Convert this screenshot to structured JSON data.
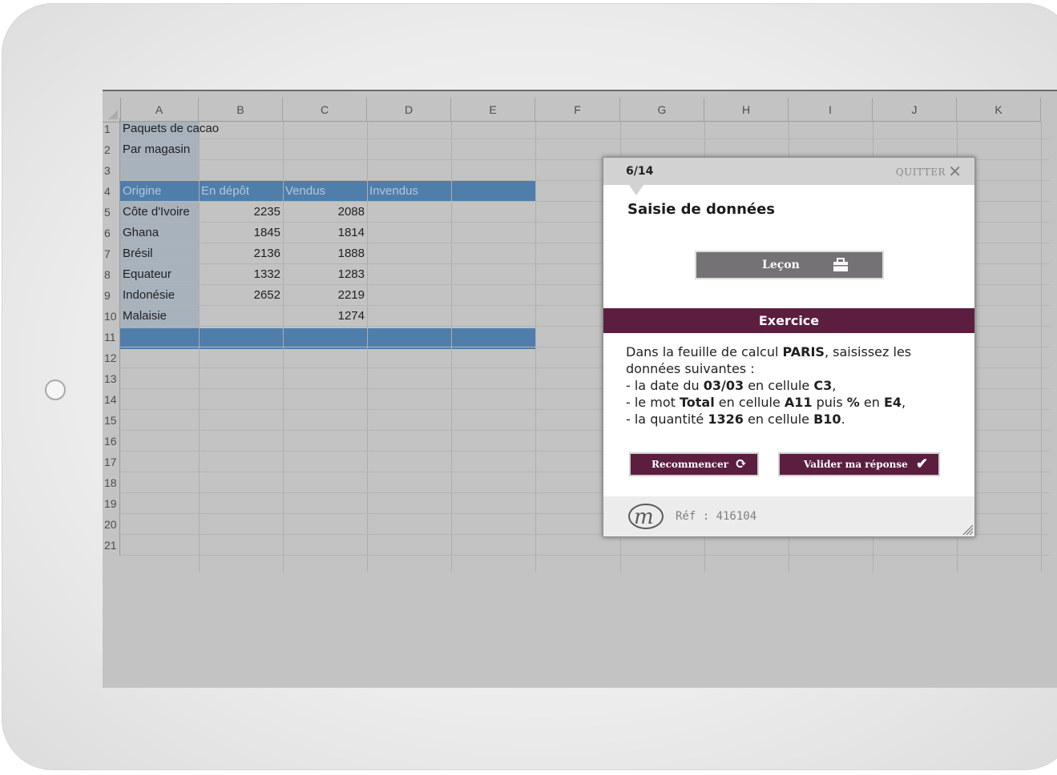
{
  "sheet": {
    "columns": [
      "A",
      "B",
      "C",
      "D",
      "E",
      "F",
      "G",
      "H",
      "I",
      "J",
      "K"
    ],
    "rows": [
      "1",
      "2",
      "3",
      "4",
      "5",
      "6",
      "7",
      "8",
      "9",
      "10",
      "11",
      "12",
      "13",
      "14",
      "15",
      "16",
      "17",
      "18",
      "19",
      "20",
      "21"
    ],
    "a1": "Paquets de cacao",
    "a2": "Par magasin",
    "headers": [
      "Origine",
      "En dépôt",
      "Vendus",
      "Invendus"
    ],
    "data": [
      {
        "origin": "Côte d'Ivoire",
        "stock": "2235",
        "sold": "2088"
      },
      {
        "origin": "Ghana",
        "stock": "1845",
        "sold": "1814"
      },
      {
        "origin": "Brésil",
        "stock": "2136",
        "sold": "1888"
      },
      {
        "origin": "Equateur",
        "stock": "1332",
        "sold": "1283"
      },
      {
        "origin": "Indonésie",
        "stock": "2652",
        "sold": "2219"
      },
      {
        "origin": "Malaisie",
        "stock": "",
        "sold": "1274"
      }
    ]
  },
  "dialog": {
    "step": "6/14",
    "quit": "QUITTER",
    "title": "Saisie de données",
    "lesson_button": "Leçon",
    "exercise_header": "Exercice",
    "instructions": {
      "l1_a": "Dans la feuille de calcul ",
      "l1_b": "PARIS",
      "l1_c": ", saisissez les données suivantes :",
      "l2_a": "- la date du ",
      "l2_b": "03/03",
      "l2_c": " en cellule ",
      "l2_d": "C3",
      "l2_e": ",",
      "l3_a": "- le mot ",
      "l3_b": "Total",
      "l3_c": " en cellule ",
      "l3_d": "A11",
      "l3_e": " puis ",
      "l3_f": "%",
      "l3_g": " en ",
      "l3_h": "E4",
      "l3_i": ",",
      "l4_a": "- la quantité ",
      "l4_b": "1326",
      "l4_c": " en cellule ",
      "l4_d": "B10",
      "l4_e": "."
    },
    "restart_button": "Recommencer",
    "validate_button": "Valider ma réponse",
    "ref": "Réf : 416104"
  },
  "icons": {
    "close": "close-icon",
    "lesson": "briefcase-icon",
    "restart": "refresh-icon",
    "validate": "checkmark-icon",
    "logo": "m-logo",
    "home": "home-button"
  },
  "colors": {
    "accent": "#5b1e3f",
    "table_header": "#4f7eab",
    "overlay": "#c3c3c3"
  }
}
